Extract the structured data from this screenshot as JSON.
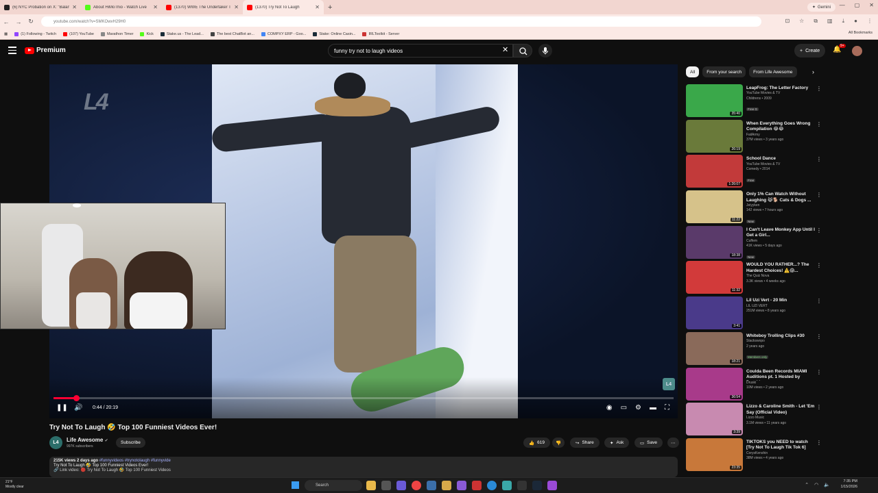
{
  "browser": {
    "tabs": [
      {
        "title": "(6) NYC Probation on X: \"Balan",
        "color": "#222"
      },
      {
        "title": "About HiMoThio - Watch Live",
        "color": "#53fc18"
      },
      {
        "title": "(1370) WWE The Undertaker Th",
        "color": "#ff0000"
      },
      {
        "title": "(1370) Try Not To Laugh",
        "color": "#ff0000"
      }
    ],
    "new_tab": "+",
    "gemini": "Gemini",
    "url": "youtube.com/watch?v=SMKOwvH29H0",
    "bookmarks": [
      {
        "label": "(1) Following - Twitch",
        "color": "#9146ff"
      },
      {
        "label": "(107) YouTube",
        "color": "#ff0000"
      },
      {
        "label": "Marathon Timer",
        "color": "#888"
      },
      {
        "label": "Kick",
        "color": "#53fc18"
      },
      {
        "label": "Stake.us - The Lead...",
        "color": "#1a2c38"
      },
      {
        "label": "The best ChatBot an...",
        "color": "#444"
      },
      {
        "label": "COMPXY ERP - Goo...",
        "color": "#4285f4"
      },
      {
        "label": "Stake: Online Casin...",
        "color": "#1a2c38"
      },
      {
        "label": "IRLToolkit - Server",
        "color": "#c33"
      }
    ],
    "all_bookmarks": "All Bookmarks"
  },
  "header": {
    "logo": "Premium",
    "search_value": "funny try not to laugh videos",
    "create": "Create",
    "notif_count": "9+"
  },
  "player": {
    "watermark": "L4",
    "corner_watermark": "L4",
    "time": "0:44 / 20:19",
    "progress": 0.036
  },
  "video": {
    "title": "Try Not To Laugh 🤣 Top 100 Funniest Videos Ever!",
    "channel": "Life Awesome",
    "channel_initials": "L4",
    "subscribers": "997K subscribers",
    "subscribe": "Subscribe",
    "likes": "619",
    "share": "Share",
    "ask": "Ask",
    "save": "Save",
    "desc_line1_stats": "215K views  2 days ago",
    "desc_line1_tags": "#funnyvideos #trynotolaugh #funnyvide",
    "desc_line2": "Try Not To Laugh 🤣 Top 100 Funniest Videos Ever!",
    "desc_line3": "🔗 Link video: 🔴 Try Not To Laugh 🤣 Top 100 Funniest Videos"
  },
  "sidebar": {
    "chips": [
      "All",
      "From your search",
      "From Life Awesome"
    ],
    "items": [
      {
        "title": "LeapFrog: The Letter Factory",
        "meta1": "YouTube Movies & TV",
        "meta2": "Childrens • 2009",
        "badge": "Free  G",
        "duration": "35:40",
        "color": "#3aa84a"
      },
      {
        "title": "When Everything Goes Wrong Compilation 😂😂",
        "meta1": "FailArmy",
        "meta2": "37M views • 3 years ago",
        "badge": "",
        "duration": "26:19",
        "color": "#6a7a3a"
      },
      {
        "title": "School Dance",
        "meta1": "YouTube Movies & TV",
        "meta2": "Comedy • 2014",
        "badge": "Free",
        "duration": "1:26:07",
        "color": "#c23a3a"
      },
      {
        "title": "Only 1% Can Watch Without Laughing 😹🐕 Cats & Dogs ...",
        "meta1": "Jeiyyken",
        "meta2": "142 views • 7 hours ago",
        "badge": "New",
        "duration": "11:22",
        "color": "#d6c28a"
      },
      {
        "title": "I Can't Leave Monkey App Until I Get a Girl...",
        "meta1": "Cuffem",
        "meta2": "41K views • 5 days ago",
        "badge": "New",
        "duration": "18:38",
        "color": "#5a3a6a"
      },
      {
        "title": "WOULD YOU RATHER...? The Hardest Choices! ⚠️😱...",
        "meta1": "The Quiz Nova",
        "meta2": "3.3K views • 4 weeks ago",
        "badge": "",
        "duration": "11:32",
        "color": "#d23a3a"
      },
      {
        "title": "Lil Uzi Vert - 20 Min",
        "meta1": "LIL UZI VERT",
        "meta2": "251M views • 8 years ago",
        "badge": "",
        "duration": "3:41",
        "color": "#4a3a8a"
      },
      {
        "title": "Whiteboy Trolling Clips #30",
        "meta1": "Stackswopo",
        "meta2": "2 years ago",
        "badge": "Members only",
        "duration": "18:21",
        "color": "#8a6a5a"
      },
      {
        "title": "Coulda Been Records MIAMI Auditions pt. 1 Hosted by Druski",
        "meta1": "Druski",
        "meta2": "10M views • 2 years ago",
        "badge": "",
        "duration": "36:54",
        "color": "#a83a8a"
      },
      {
        "title": "Lizzo & Caroline Smith - Let 'Em Say (Official Video)",
        "meta1": "Lizzo Music",
        "meta2": "3.1M views • 11 years ago",
        "badge": "",
        "duration": "3:39",
        "color": "#c88ab0"
      },
      {
        "title": "TIKTOKS you NEED to watch [Try Not To Laugh Tik Tok 6]",
        "meta1": "CorysKenshin",
        "meta2": "38M views • 4 years ago",
        "badge": "",
        "duration": "23:35",
        "color": "#c8783a"
      }
    ]
  },
  "taskbar": {
    "weather_temp": "21°F",
    "weather_desc": "Mostly clear",
    "search": "Search",
    "time": "7:35 PM",
    "date": "1/15/2026"
  }
}
